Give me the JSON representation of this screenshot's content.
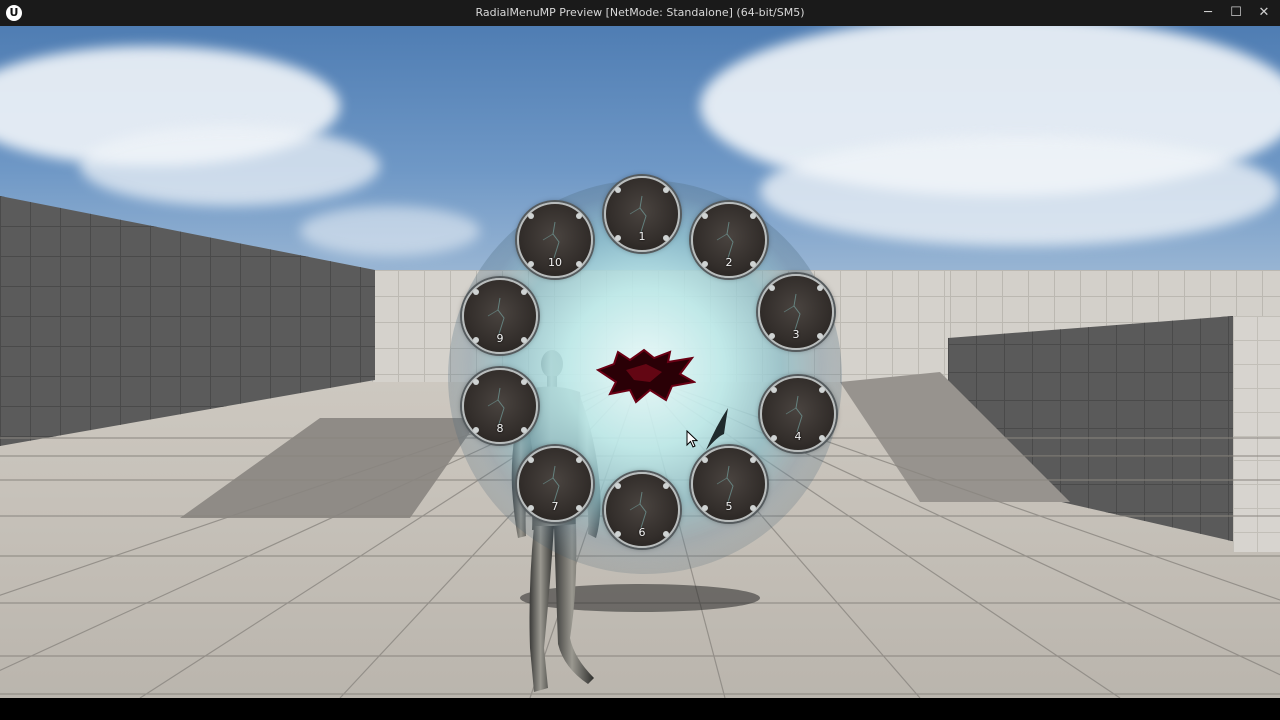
{
  "window": {
    "title": "RadialMenuMP Preview [NetMode: Standalone]  (64-bit/SM5)",
    "logo": "U",
    "minimize_glyph": "─",
    "maximize_glyph": "☐",
    "close_glyph": "✕"
  },
  "radial_menu": {
    "slots": [
      {
        "label": "1"
      },
      {
        "label": "2"
      },
      {
        "label": "3"
      },
      {
        "label": "4"
      },
      {
        "label": "5"
      },
      {
        "label": "6"
      },
      {
        "label": "7"
      },
      {
        "label": "8"
      },
      {
        "label": "9"
      },
      {
        "label": "10"
      }
    ]
  },
  "icons": {
    "logo": "unreal-logo-icon",
    "cursor": "mouse-cursor-icon",
    "pointer": "radial-pointer-icon"
  },
  "colors": {
    "glow": "#d6f3f2",
    "slot_fill": "#332e2b",
    "slot_rim": "#b9bdbd",
    "center_burst": "#3a0008"
  }
}
